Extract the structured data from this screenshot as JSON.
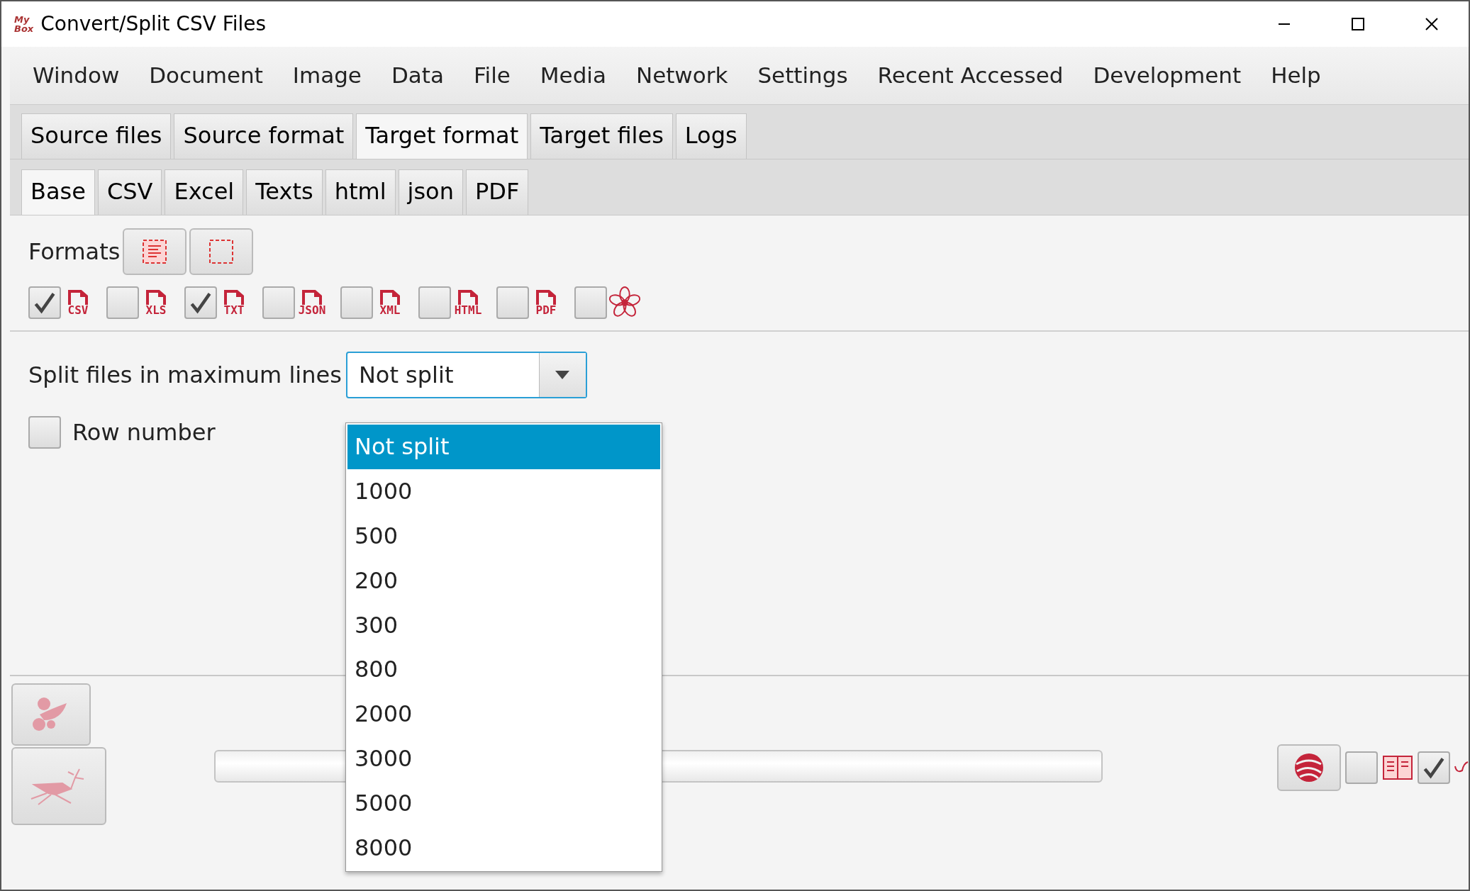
{
  "window": {
    "title": "Convert/Split CSV Files",
    "logo_text": [
      "My",
      "Box"
    ]
  },
  "menu": [
    "Window",
    "Document",
    "Image",
    "Data",
    "File",
    "Media",
    "Network",
    "Settings",
    "Recent Accessed",
    "Development",
    "Help"
  ],
  "tabs": [
    {
      "label": "Source files",
      "selected": false
    },
    {
      "label": "Source format",
      "selected": false
    },
    {
      "label": "Target format",
      "selected": true
    },
    {
      "label": "Target files",
      "selected": false
    },
    {
      "label": "Logs",
      "selected": false
    }
  ],
  "subtabs": [
    {
      "label": "Base",
      "selected": true
    },
    {
      "label": "CSV",
      "selected": false
    },
    {
      "label": "Excel",
      "selected": false
    },
    {
      "label": "Texts",
      "selected": false
    },
    {
      "label": "html",
      "selected": false
    },
    {
      "label": "json",
      "selected": false
    },
    {
      "label": "PDF",
      "selected": false
    }
  ],
  "formats": {
    "label": "Formats",
    "options": [
      {
        "kind": "file",
        "label": "CSV",
        "checked": true
      },
      {
        "kind": "file",
        "label": "XLS",
        "checked": false
      },
      {
        "kind": "file",
        "label": "TXT",
        "checked": true
      },
      {
        "kind": "file",
        "label": "JSON",
        "checked": false
      },
      {
        "kind": "file",
        "label": "XML",
        "checked": false
      },
      {
        "kind": "file",
        "label": "HTML",
        "checked": false
      },
      {
        "kind": "file",
        "label": "PDF",
        "checked": false
      },
      {
        "kind": "flower",
        "checked": false
      }
    ]
  },
  "split": {
    "label": "Split files in maximum lines",
    "value": "Not split",
    "expanded": true,
    "options": [
      {
        "label": "Not split",
        "selected": true
      },
      {
        "label": "1000",
        "selected": false
      },
      {
        "label": "500",
        "selected": false
      },
      {
        "label": "200",
        "selected": false
      },
      {
        "label": "300",
        "selected": false
      },
      {
        "label": "800",
        "selected": false
      },
      {
        "label": "2000",
        "selected": false
      },
      {
        "label": "3000",
        "selected": false
      },
      {
        "label": "5000",
        "selected": false
      },
      {
        "label": "8000",
        "selected": false
      }
    ]
  },
  "row_number": {
    "label": "Row number",
    "checked": false
  },
  "progress": {
    "level": 0
  },
  "bottom_checks": [
    {
      "checked": false
    },
    {
      "checked": true
    }
  ]
}
